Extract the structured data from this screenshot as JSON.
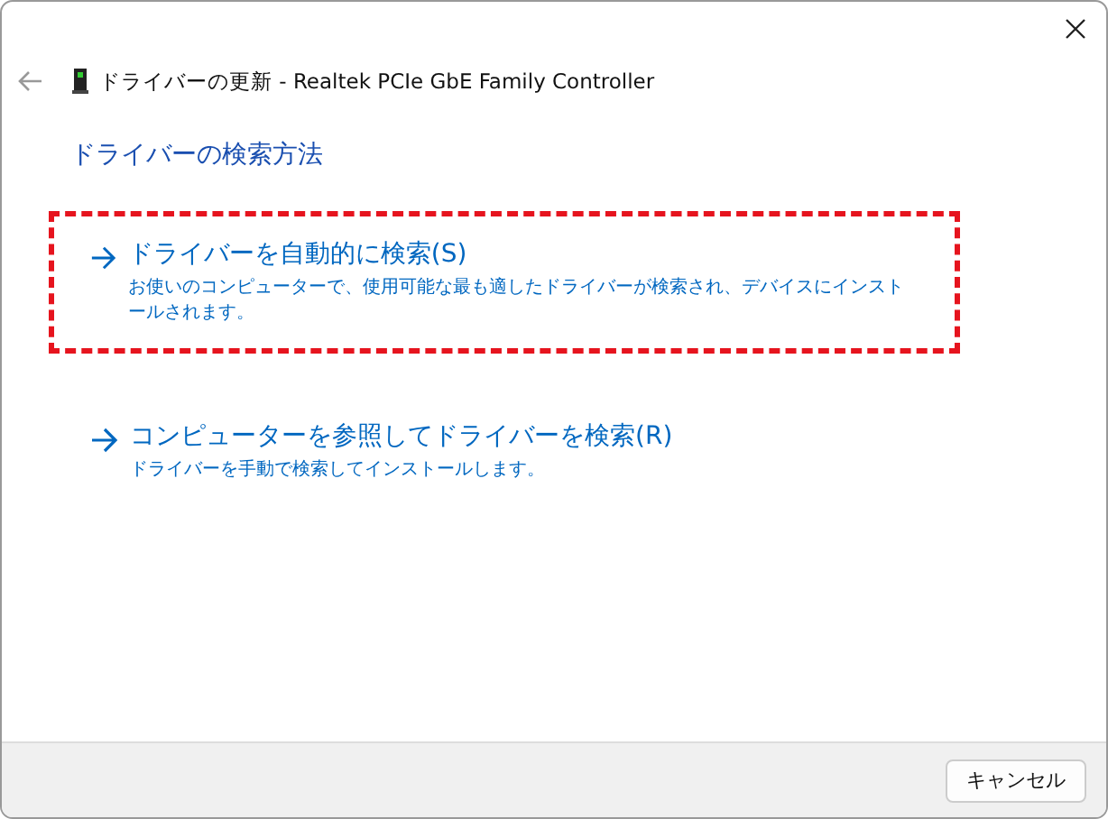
{
  "window": {
    "title": "ドライバーの更新 - Realtek PCIe GbE Family Controller"
  },
  "heading": "ドライバーの検索方法",
  "options": [
    {
      "title": "ドライバーを自動的に検索(S)",
      "description": "お使いのコンピューターで、使用可能な最も適したドライバーが検索され、デバイスにインストールされます。",
      "highlighted": true
    },
    {
      "title": "コンピューターを参照してドライバーを検索(R)",
      "description": "ドライバーを手動で検索してインストールします。",
      "highlighted": false
    }
  ],
  "buttons": [
    "キャンセル"
  ]
}
